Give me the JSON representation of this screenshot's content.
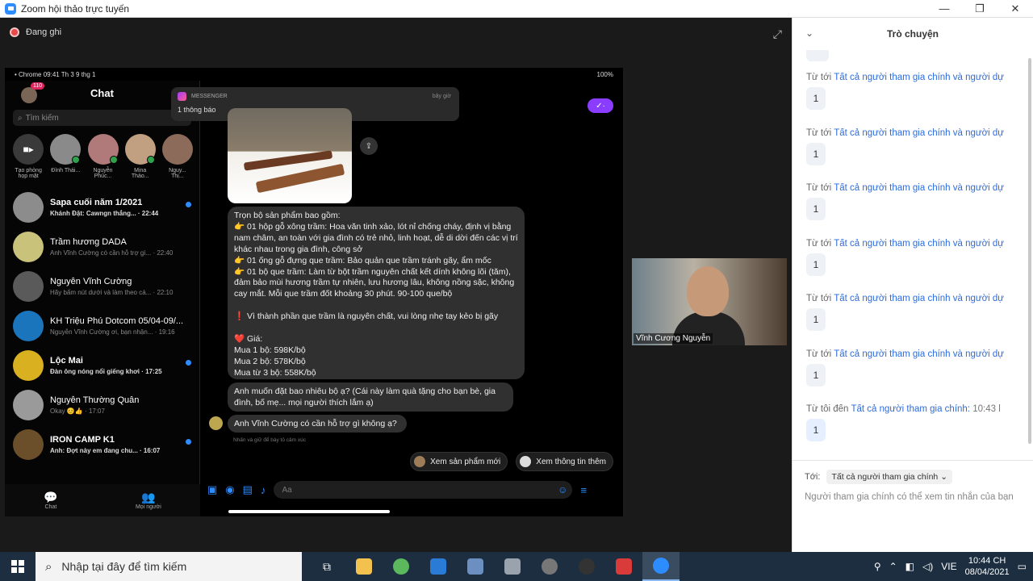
{
  "window": {
    "title": "Zoom hội thảo trực tuyến",
    "minimize": "—",
    "restore": "❐",
    "close": "✕"
  },
  "recording": {
    "label": "Đang ghi"
  },
  "phone": {
    "status_left": "• Chrome  09:41  Th 3 9 thg 1",
    "status_right": "100%",
    "chat_title": "Chat",
    "badge": "110",
    "search_placeholder": "Tìm kiếm",
    "stories": [
      {
        "label": "Tạo phòng họp mặt",
        "color": "#3a3a3a",
        "live": false
      },
      {
        "label": "Đình Thái...",
        "color": "#8a8a8a",
        "live": true
      },
      {
        "label": "Nguyễn Phúc...",
        "color": "#b07a7a",
        "live": true
      },
      {
        "label": "Mina Thảo...",
        "color": "#c0a080",
        "live": true
      },
      {
        "label": "Nguy... Thị...",
        "color": "#8d6b5a",
        "live": false
      }
    ],
    "conversations": [
      {
        "name": "Sapa cuối năm 1/2021",
        "preview": "Khánh Đặt: Cawngn thẳng...",
        "time": "22:44",
        "unread": true,
        "color": "#8c8c8c"
      },
      {
        "name": "Trầm hương DADA",
        "preview": "Anh Vĩnh Cường có cần hỗ trợ gì...",
        "time": "22:40",
        "unread": false,
        "color": "#c8c27a"
      },
      {
        "name": "Nguyễn Vĩnh Cường",
        "preview": "Hãy bấm nút dưới và làm theo cá...",
        "time": "22:10",
        "unread": false,
        "color": "#5a5a5a"
      },
      {
        "name": "KH Triệu Phú Dotcom 05/04-09/...",
        "preview": "Nguyễn Vĩnh Cường ơi, bạn nhận...",
        "time": "19:16",
        "unread": false,
        "color": "#1b75bc"
      },
      {
        "name": "Lộc Mai",
        "preview": "Đàn ông nóng nổi giếng khơi",
        "time": "17:25",
        "unread": true,
        "color": "#d8b020"
      },
      {
        "name": "Nguyễn Thường Quân",
        "preview": "Okay 😊👍",
        "time": "17:07",
        "unread": false,
        "color": "#9a9a9a"
      },
      {
        "name": "IRON CAMP K1",
        "preview": "Anh: Đợt này em đang chu...",
        "time": "16:07",
        "unread": true,
        "color": "#6b4f2a"
      }
    ],
    "tabs": [
      {
        "label": "Chat",
        "icon": "💬"
      },
      {
        "label": "Mọi người",
        "icon": "👥"
      }
    ],
    "notification": {
      "app": "MESSENGER",
      "time": "bây giờ",
      "body": "1 thông báo"
    },
    "message_main": "Trọn bộ sản phẩm bao gồm:\n👉 01 hộp gỗ xông trầm: Hoa văn tinh xảo, lót nỉ chống cháy, định vị bằng nam châm, an toàn với gia đình có trẻ nhỏ, linh hoạt, dễ di dời đến các vị trí khác nhau trong gia đình, công sở\n👉 01 ống gỗ đựng que trầm: Bảo quản que trầm tránh gãy, ẩm mốc\n👉 01 bộ que trầm: Làm từ bột trầm nguyên chất kết dính không lõi (tăm), đảm bảo mùi hương trầm tự nhiên, lưu hương lâu, không nồng sặc, không cay mắt. Mỗi que trầm đốt khoảng 30 phút. 90-100 que/bộ\n\n❗ Vì thành phần que trầm là nguyên chất, vui lòng nhẹ tay kẻo bị gãy\n\n❤️ Giá:\nMua 1 bộ: 598K/bộ\nMua 2 bộ: 578K/bộ\nMua từ 3 bộ: 558K/bộ",
    "message_2": "Anh muốn đặt bao nhiêu bộ ạ? (Cái này làm quà tặng cho bạn bè, gia đình, bố mẹ... mọi người thích lắm ạ)",
    "message_3": "Anh Vĩnh Cường có cần hỗ trợ gì không ạ?",
    "note": "Nhấn và giữ để bày tỏ cảm xúc",
    "quick_replies": [
      "Xem sản phẩm mới",
      "Xem thông tin thêm"
    ],
    "composer_placeholder": "Aa"
  },
  "video": {
    "name": "Vĩnh Cương Nguyễn"
  },
  "chat": {
    "title": "Trò chuyện",
    "messages": [
      {
        "from": "Từ  tới ",
        "to": "Tất cả người tham gia chính và người dự",
        "time": "",
        "text": "1"
      },
      {
        "from": "Từ  tới ",
        "to": "Tất cả người tham gia chính và người dự",
        "time": "",
        "text": "1"
      },
      {
        "from": "Từ  tới ",
        "to": "Tất cả người tham gia chính và người dự",
        "time": "",
        "text": "1"
      },
      {
        "from": "Từ  tới ",
        "to": "Tất cả người tham gia chính và người dự",
        "time": "",
        "text": "1"
      },
      {
        "from": "Từ  tới ",
        "to": "Tất cả người tham gia chính và người dự",
        "time": "",
        "text": "1"
      },
      {
        "from": "Từ  tới ",
        "to": "Tất cả người tham gia chính và người dự",
        "time": "",
        "text": "1"
      },
      {
        "from": "Từ tôi đến ",
        "to": "Tất cả người tham gia chính:",
        "time": "10:43 l",
        "text": "1"
      }
    ],
    "to_label": "Tới:",
    "to_select": "Tất cả người tham gia chính",
    "input_placeholder": "Người tham gia chính có thể xem tin nhắn của bạn"
  },
  "taskbar": {
    "search_placeholder": "Nhập tại đây để tìm kiếm",
    "apps": [
      {
        "name": "task-view",
        "color": "#1c2e3f",
        "glyph": "⧉"
      },
      {
        "name": "file-explorer",
        "color": "#f2c14e",
        "glyph": ""
      },
      {
        "name": "app-green",
        "color": "#5bb85d",
        "glyph": ""
      },
      {
        "name": "app-media",
        "color": "#2a7bd6",
        "glyph": ""
      },
      {
        "name": "app-monitor",
        "color": "#6a8fc0",
        "glyph": ""
      },
      {
        "name": "calculator",
        "color": "#9aa3ad",
        "glyph": ""
      },
      {
        "name": "app-gray",
        "color": "#777",
        "glyph": ""
      },
      {
        "name": "app-obs",
        "color": "#333",
        "glyph": ""
      },
      {
        "name": "app-red",
        "color": "#d93a3a",
        "glyph": ""
      },
      {
        "name": "zoom",
        "color": "#2d8cff",
        "glyph": ""
      }
    ],
    "lang": "VIE",
    "time": "10:44 CH",
    "date": "08/04/2021"
  }
}
